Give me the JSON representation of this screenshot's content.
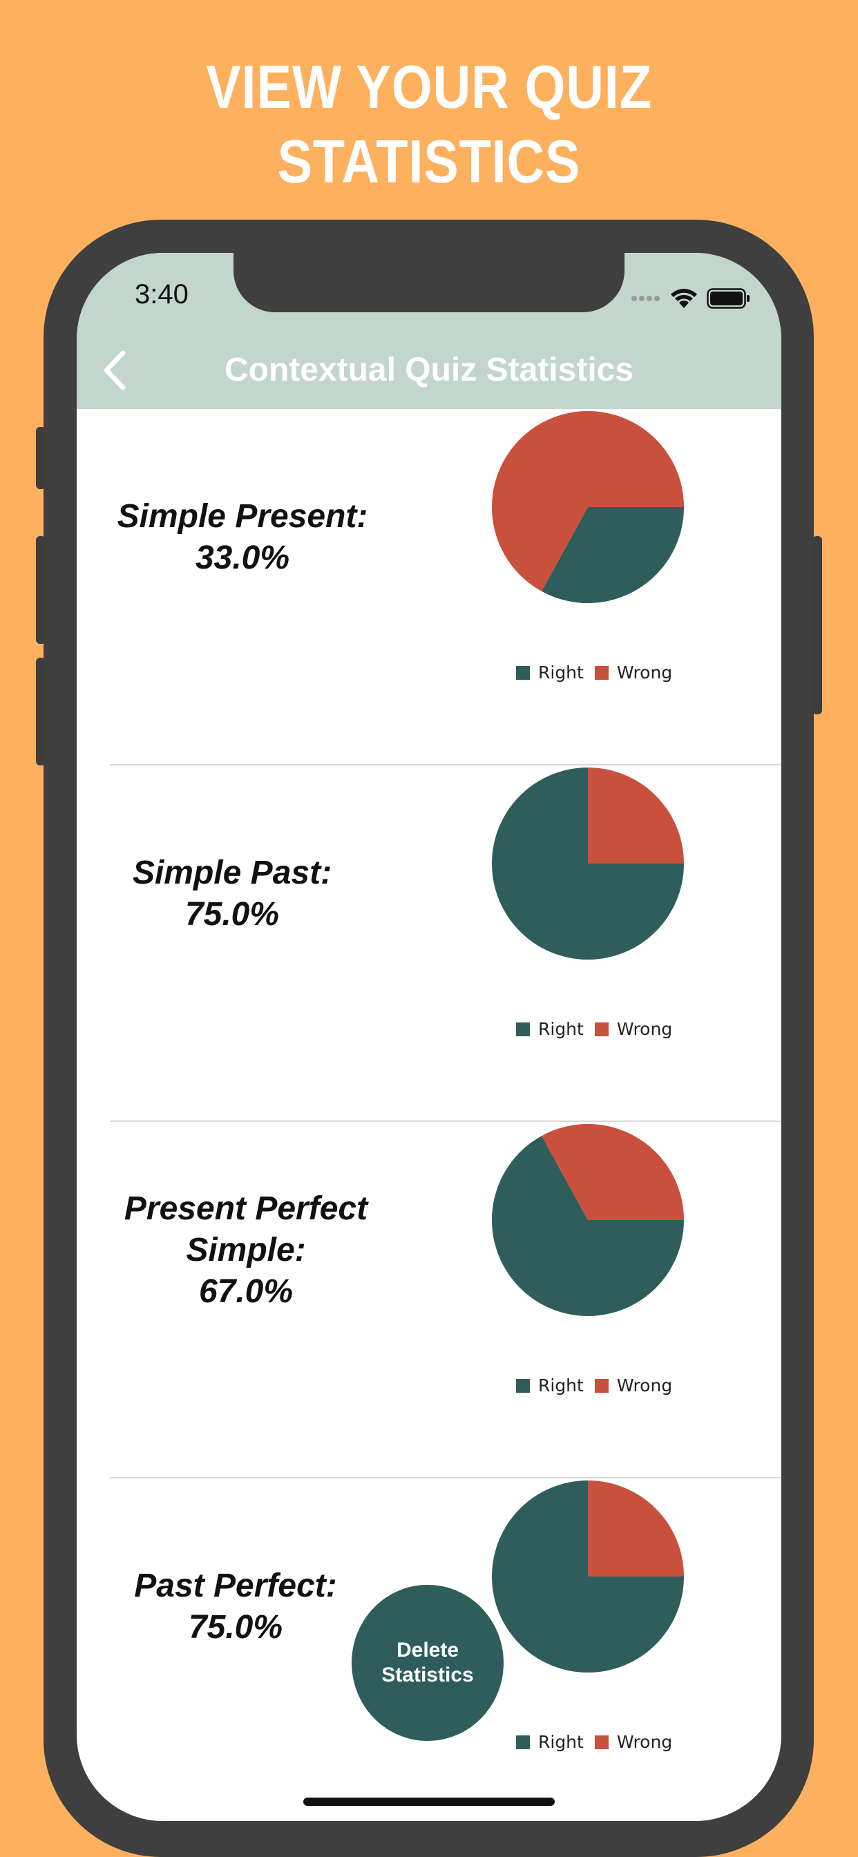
{
  "headline": {
    "line1": "VIEW YOUR QUIZ",
    "line2": "STATISTICS"
  },
  "status_bar": {
    "time": "3:40",
    "icons": [
      "signal-icon",
      "wifi-icon",
      "battery-icon"
    ]
  },
  "nav": {
    "title": "Contextual Quiz Statistics",
    "back_icon": "chevron-left-icon"
  },
  "legend": {
    "right_label": "Right",
    "wrong_label": "Wrong"
  },
  "colors": {
    "background": "#FDB05E",
    "nav_bar": "#C2D6CD",
    "right": "#2F5D5B",
    "wrong": "#C9503C"
  },
  "stats": [
    {
      "label_lines": [
        "Simple Present:",
        "33.0%"
      ],
      "right_fraction": 0.33
    },
    {
      "label_lines": [
        "Simple Past:",
        "75.0%"
      ],
      "right_fraction": 0.75
    },
    {
      "label_lines": [
        "Present Perfect",
        "Simple:",
        "67.0%"
      ],
      "right_fraction": 0.67
    },
    {
      "label_lines": [
        "Past Perfect:",
        "75.0%"
      ],
      "right_fraction": 0.75
    }
  ],
  "delete_button": {
    "line1": "Delete",
    "line2": "Statistics"
  }
}
